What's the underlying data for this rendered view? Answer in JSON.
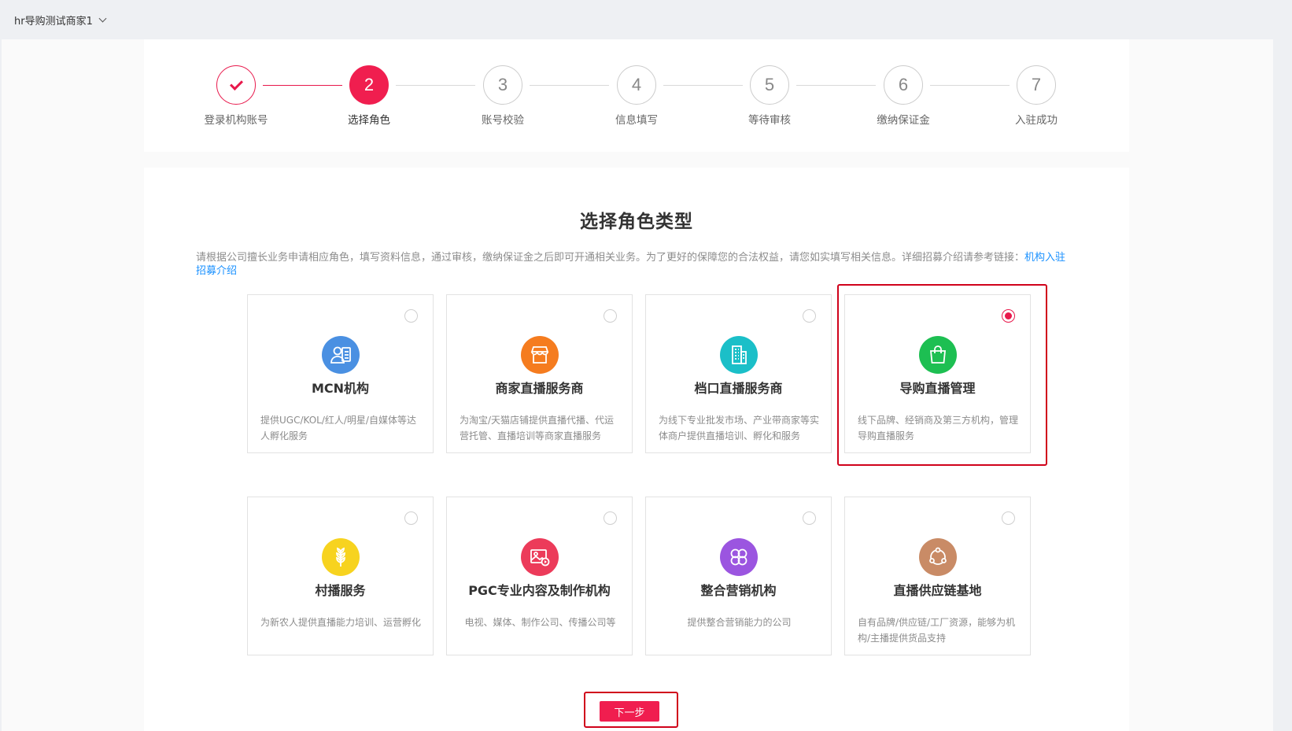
{
  "header": {
    "merchant_name": "hr导购测试商家1"
  },
  "steps": [
    {
      "num": "",
      "label": "登录机构账号",
      "state": "done"
    },
    {
      "num": "2",
      "label": "选择角色",
      "state": "active"
    },
    {
      "num": "3",
      "label": "账号校验",
      "state": "pending"
    },
    {
      "num": "4",
      "label": "信息填写",
      "state": "pending"
    },
    {
      "num": "5",
      "label": "等待审核",
      "state": "pending"
    },
    {
      "num": "6",
      "label": "缴纳保证金",
      "state": "pending"
    },
    {
      "num": "7",
      "label": "入驻成功",
      "state": "pending"
    }
  ],
  "page": {
    "title": "选择角色类型",
    "description": "请根据公司擅长业务申请相应角色，填写资料信息，通过审核，缴纳保证金之后即可开通相关业务。为了更好的保障您的合法权益，请您如实填写相关信息。详细招募介绍请参考链接：",
    "link_text": "机构入驻招募介绍"
  },
  "roles": [
    {
      "name": "MCN机构",
      "desc": "提供UGC/KOL/红人/明星/自媒体等达人孵化服务",
      "icon": "person-card-icon",
      "color": "#4a90e2",
      "selected": false
    },
    {
      "name": "商家直播服务商",
      "desc": "为淘宝/天猫店铺提供直播代播、代运营托管、直播培训等商家直播服务",
      "icon": "store-icon",
      "color": "#f57c1f",
      "selected": false
    },
    {
      "name": "档口直播服务商",
      "desc": "为线下专业批发市场、产业带商家等实体商户提供直播培训、孵化和服务",
      "icon": "building-icon",
      "color": "#1bbfc8",
      "selected": false
    },
    {
      "name": "导购直播管理",
      "desc": "线下品牌、经销商及第三方机构，管理导购直播服务",
      "icon": "shopping-bag-icon",
      "color": "#1dbf52",
      "selected": true
    },
    {
      "name": "村播服务",
      "desc": "为新农人提供直播能力培训、运营孵化",
      "icon": "wheat-icon",
      "color": "#f7d31f",
      "selected": false
    },
    {
      "name": "PGC专业内容及制作机构",
      "desc": "电视、媒体、制作公司、传播公司等",
      "icon": "media-icon",
      "color": "#ec3b5a",
      "selected": false
    },
    {
      "name": "整合营销机构",
      "desc": "提供整合营销能力的公司",
      "icon": "clover-icon",
      "color": "#9b55e0",
      "selected": false
    },
    {
      "name": "直播供应链基地",
      "desc": "自有品牌/供应链/工厂资源，能够为机构/主播提供货品支持",
      "icon": "cycle-icon",
      "color": "#c98b66",
      "selected": false
    }
  ],
  "actions": {
    "next_label": "下一步"
  }
}
